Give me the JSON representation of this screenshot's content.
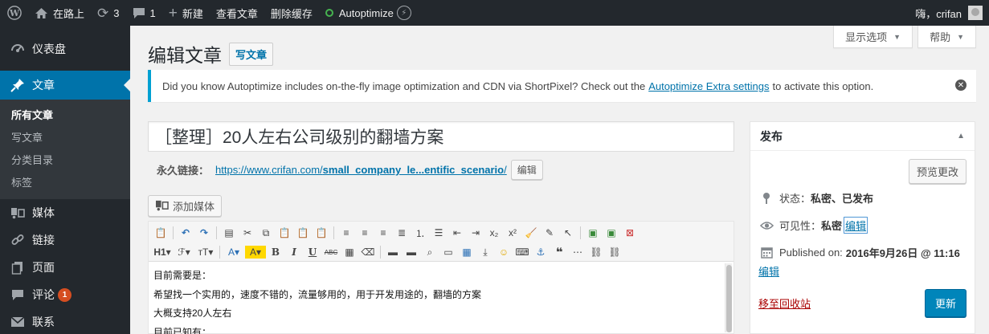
{
  "adminbar": {
    "site_name": "在路上",
    "updates_count": "3",
    "comments_count": "1",
    "new_label": "新建",
    "view_post": "查看文章",
    "clear_cache": "删除缓存",
    "autoptimize": "Autoptimize",
    "greeting": "嗨，crifan"
  },
  "sidebar": {
    "dashboard": "仪表盘",
    "posts": "文章",
    "submenu": [
      "所有文章",
      "写文章",
      "分类目录",
      "标签"
    ],
    "media": "媒体",
    "links": "链接",
    "pages": "页面",
    "comments": "评论",
    "comments_badge": "1",
    "contact": "联系"
  },
  "screen_options": {
    "options_label": "显示选项",
    "help_label": "帮助"
  },
  "header": {
    "title": "编辑文章",
    "add_new": "写文章"
  },
  "notice": {
    "text_before": "Did you know Autoptimize includes on-the-fly image optimization and CDN via ShortPixel? Check out the",
    "link": "Autoptimize Extra settings",
    "text_after": "to activate this option."
  },
  "post": {
    "title": "［整理］20人左右公司级别的翻墙方案",
    "permalink_label": "永久链接：",
    "permalink_base": "https://www.crifan.com/",
    "permalink_slug": "small_company_le...entific_scenario",
    "permalink_end": "/",
    "permalink_edit": "编辑",
    "add_media": "添加媒体",
    "content_lines": [
      "目前需要是：",
      "希望找一个实用的，速度不错的，流量够用的，用于开发用途的，翻墙的方案",
      "大概支持20人左右",
      "目前已知有："
    ]
  },
  "publish": {
    "title": "发布",
    "preview": "预览更改",
    "status_label": "状态：",
    "status_value": "私密、已发布",
    "visibility_label": "可见性：",
    "visibility_value": "私密",
    "visibility_edit": "编辑",
    "published_label": "Published on:",
    "published_value": "2016年9月26日 @ 11:16",
    "date_edit": "编辑",
    "trash": "移至回收站",
    "update": "更新"
  },
  "colors": {
    "adminbar": "#23282d",
    "accent": "#0073aa",
    "primary_button": "#0085ba",
    "notice_border": "#00a0d2",
    "badge": "#d54e21",
    "trash": "#a00"
  }
}
